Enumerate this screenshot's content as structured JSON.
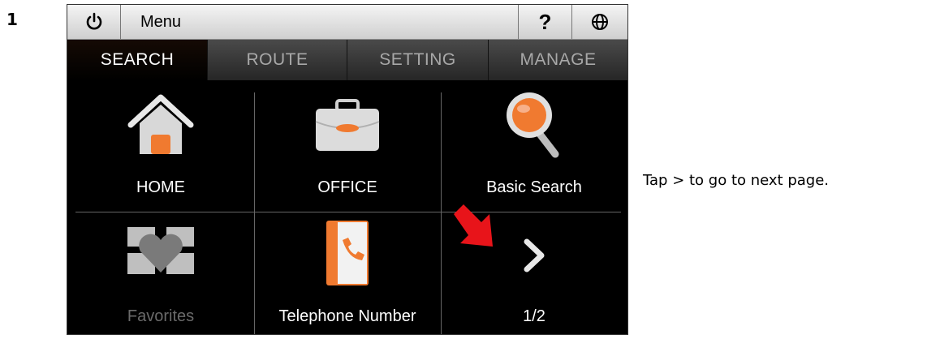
{
  "step_number": "1",
  "menubar": {
    "power_icon": "power-icon",
    "menu_label": "Menu",
    "help_label": "?",
    "globe_icon": "globe-icon"
  },
  "tabs": [
    {
      "label": "SEARCH",
      "active": true
    },
    {
      "label": "ROUTE",
      "active": false
    },
    {
      "label": "SETTING",
      "active": false
    },
    {
      "label": "MANAGE",
      "active": false
    }
  ],
  "grid": {
    "items": [
      {
        "label": "HOME",
        "icon": "home-icon",
        "enabled": true
      },
      {
        "label": "OFFICE",
        "icon": "briefcase-icon",
        "enabled": true
      },
      {
        "label": "Basic Search",
        "icon": "magnifier-icon",
        "enabled": true
      },
      {
        "label": "Favorites",
        "icon": "favorites-icon",
        "enabled": false
      },
      {
        "label": "Telephone Number",
        "icon": "phonebook-icon",
        "enabled": true
      },
      {
        "label": "1/2",
        "icon": "chevron-right-icon",
        "enabled": true
      }
    ],
    "next_annotation_icon": "red-arrow-icon"
  },
  "caption": "Tap > to go to next page.",
  "colors": {
    "accent_orange": "#f07a30",
    "annotation_red": "#e8141a"
  }
}
